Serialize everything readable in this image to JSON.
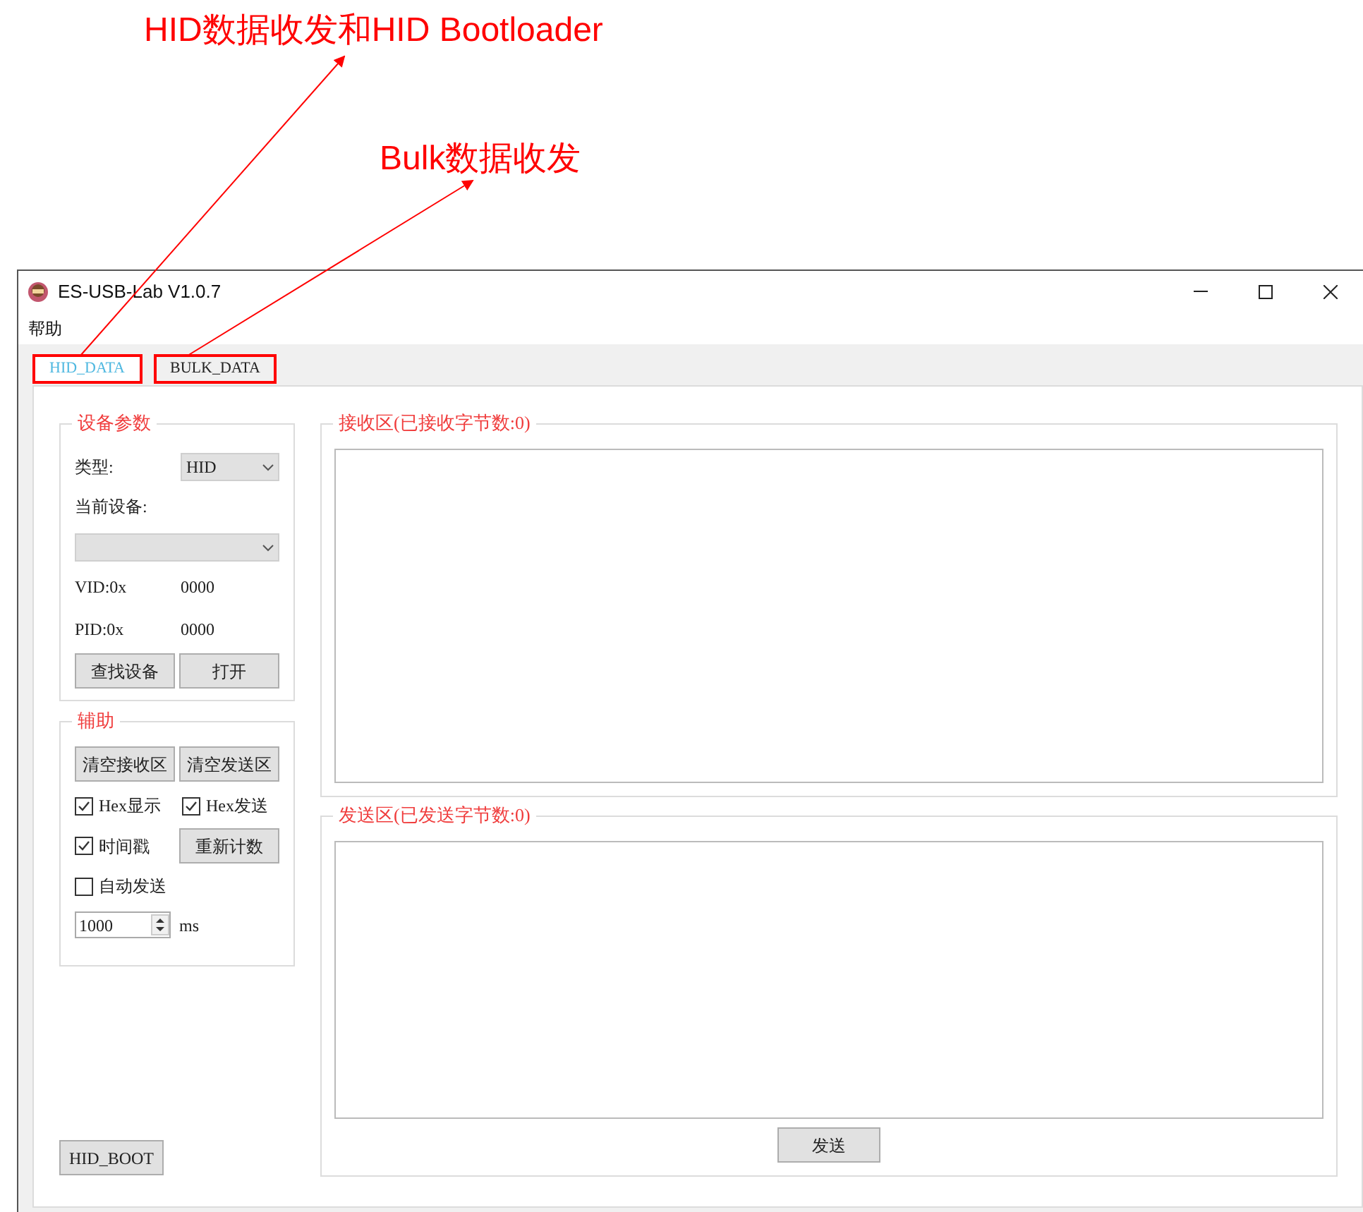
{
  "annotations": [
    {
      "text": "HID数据收发和HID Bootloader"
    },
    {
      "text": "Bulk数据收发"
    }
  ],
  "window": {
    "title": "ES-USB-Lab V1.0.7"
  },
  "menu": [
    "帮助"
  ],
  "tabs": [
    {
      "label": "HID_DATA",
      "selected": true,
      "annotated": true
    },
    {
      "label": "BULK_DATA",
      "selected": false,
      "annotated": true
    }
  ],
  "device_group": {
    "title": "设备参数",
    "type_label": "类型:",
    "type_value": "HID",
    "device_label": "当前设备:",
    "vid_label": "VID:0x",
    "vid_value": "0000",
    "pid_label": "PID:0x",
    "pid_value": "0000",
    "buttons": [
      "查找设备",
      "打开"
    ]
  },
  "assist_group": {
    "title": "辅助",
    "buttons": [
      "清空接收区",
      "清空发送区"
    ],
    "checkboxes": [
      {
        "label": "Hex显示",
        "checked": true
      },
      {
        "label": "Hex发送",
        "checked": true
      },
      {
        "label": "时间戳",
        "checked": true
      },
      {
        "label": "自动发送",
        "checked": false
      }
    ],
    "reset_button": "重新计数",
    "interval": "1000",
    "interval_unit": "ms"
  },
  "hid_boot_button": "HID_BOOT",
  "receive_area": {
    "title": "接收区(已接收字节数:0)"
  },
  "send_area": {
    "title": "发送区(已发送字节数:0)",
    "button": "发送"
  }
}
